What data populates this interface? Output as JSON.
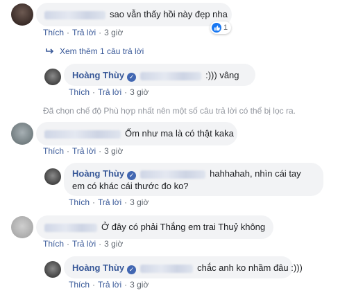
{
  "actions": {
    "like": "Thích",
    "reply": "Trả lời",
    "separator": "·",
    "time": "3 giờ"
  },
  "verified_icon": "verified-badge-icon",
  "comments": [
    {
      "text": "sao vẫn thấy hồi này đẹp nha",
      "reaction": {
        "icon": "like-icon",
        "count": "1"
      },
      "see_more": "Xem thêm 1 câu trả lời",
      "reply": {
        "author": "Hoàng Thùy",
        "text": ":))) vâng"
      }
    },
    {
      "text": "Ốm như ma là có thật kaka",
      "reply": {
        "author": "Hoàng Thùy",
        "text_line1": "hahhahah, nhìn cái tay",
        "text_line2": "em có khác cái thước đo ko?"
      }
    },
    {
      "text": "Ở đây có phải Thắng em trai Thuỷ không",
      "reply": {
        "author": "Hoàng Thùy",
        "text": "chắc anh ko nhầm đâu :)))"
      }
    }
  ],
  "filter_notice": "Đã chọn chế độ Phù hợp nhất nên một số câu trả lời có thể bị lọc ra.",
  "colors": {
    "link": "#385898",
    "bubble": "#f2f3f5",
    "muted": "#606770",
    "notice": "#90949c",
    "like_blue": "#1877f2"
  }
}
